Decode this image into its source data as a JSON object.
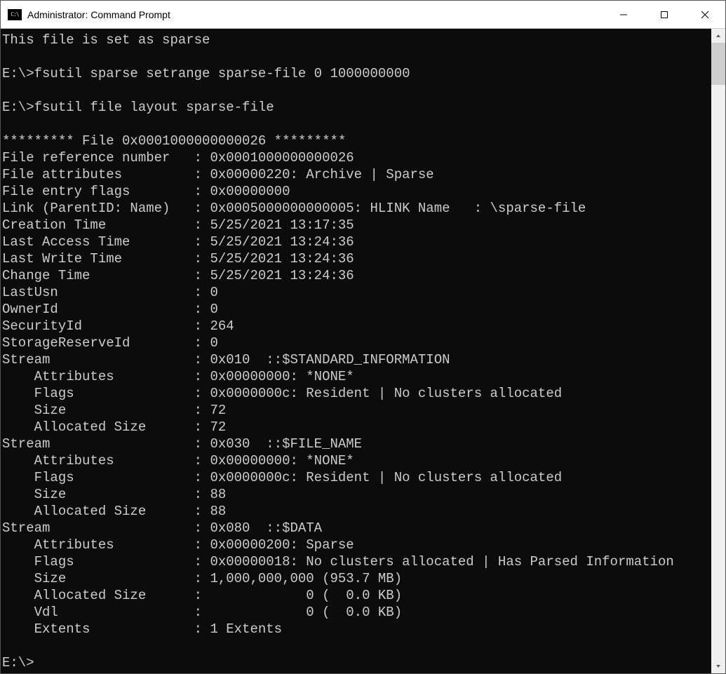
{
  "window": {
    "title": "Administrator: Command Prompt"
  },
  "console": {
    "lines": [
      "This file is set as sparse",
      "",
      "E:\\>fsutil sparse setrange sparse-file 0 1000000000",
      "",
      "E:\\>fsutil file layout sparse-file",
      "",
      "********* File 0x0001000000000026 *********",
      "File reference number   : 0x0001000000000026",
      "File attributes         : 0x00000220: Archive | Sparse",
      "File entry flags        : 0x00000000",
      "Link (ParentID: Name)   : 0x0005000000000005: HLINK Name   : \\sparse-file",
      "Creation Time           : 5/25/2021 13:17:35",
      "Last Access Time        : 5/25/2021 13:24:36",
      "Last Write Time         : 5/25/2021 13:24:36",
      "Change Time             : 5/25/2021 13:24:36",
      "LastUsn                 : 0",
      "OwnerId                 : 0",
      "SecurityId              : 264",
      "StorageReserveId        : 0",
      "Stream                  : 0x010  ::$STANDARD_INFORMATION",
      "    Attributes          : 0x00000000: *NONE*",
      "    Flags               : 0x0000000c: Resident | No clusters allocated",
      "    Size                : 72",
      "    Allocated Size      : 72",
      "Stream                  : 0x030  ::$FILE_NAME",
      "    Attributes          : 0x00000000: *NONE*",
      "    Flags               : 0x0000000c: Resident | No clusters allocated",
      "    Size                : 88",
      "    Allocated Size      : 88",
      "Stream                  : 0x080  ::$DATA",
      "    Attributes          : 0x00000200: Sparse",
      "    Flags               : 0x00000018: No clusters allocated | Has Parsed Information",
      "    Size                : 1,000,000,000 (953.7 MB)",
      "    Allocated Size      :             0 (  0.0 KB)",
      "    Vdl                 :             0 (  0.0 KB)",
      "    Extents             : 1 Extents",
      "",
      "E:\\>"
    ]
  }
}
